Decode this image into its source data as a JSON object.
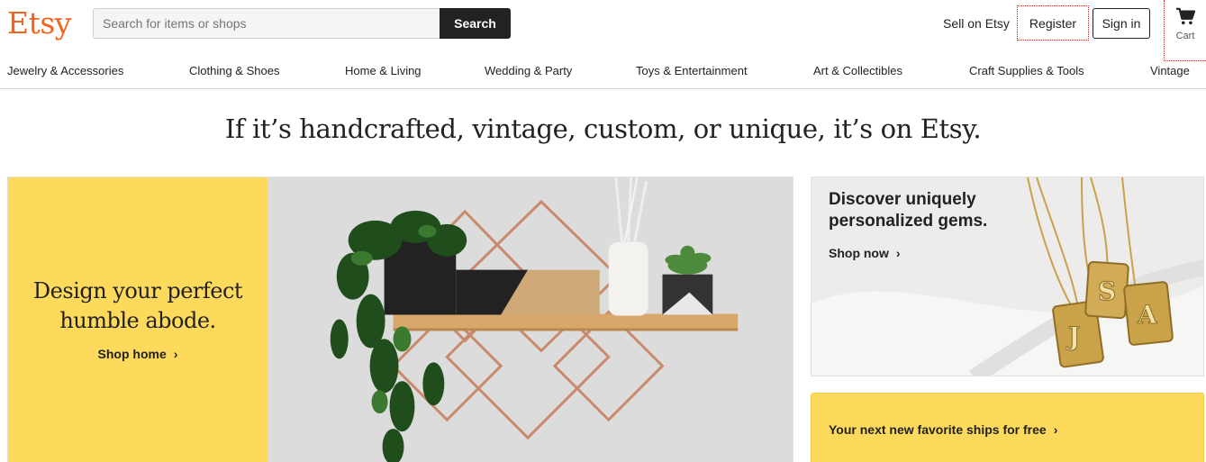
{
  "header": {
    "logo": "Etsy",
    "search_placeholder": "Search for items or shops",
    "search_button": "Search",
    "sell_link": "Sell on Etsy",
    "register": "Register",
    "sign_in": "Sign in",
    "cart_label": "Cart",
    "cart_icon": "cart-icon"
  },
  "categories": [
    "Jewelry & Accessories",
    "Clothing & Shoes",
    "Home & Living",
    "Wedding & Party",
    "Toys & Entertainment",
    "Art & Collectibles",
    "Craft Supplies & Tools",
    "Vintage"
  ],
  "tagline": "If it’s handcrafted, vintage, custom, or unique, it’s on Etsy.",
  "hero": {
    "title_line1": "Design your perfect",
    "title_line2": "humble abode.",
    "link": "Shop home",
    "chevron": "›"
  },
  "promo": {
    "title_line1": "Discover uniquely",
    "title_line2": "personalized gems.",
    "link": "Shop now",
    "chevron": "›",
    "pendant_letters": [
      "J",
      "S",
      "A"
    ]
  },
  "shipping": {
    "link": "Your next new favorite ships for free",
    "chevron": "›"
  },
  "colors": {
    "brand": "#f1641e",
    "promo_yellow": "#fdd95c",
    "dark": "#222222"
  }
}
